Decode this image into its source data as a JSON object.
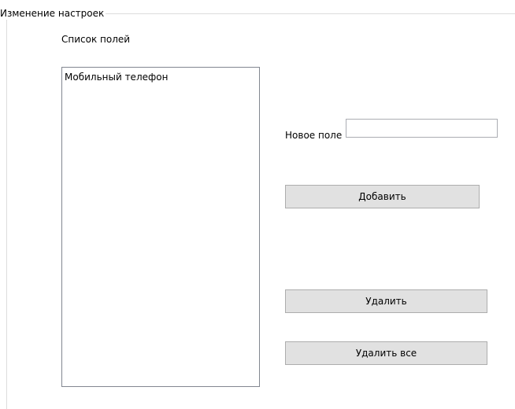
{
  "group": {
    "title": "Изменение настроек"
  },
  "fields_list": {
    "label": "Список полей",
    "items": [
      "Мобильный телефон"
    ]
  },
  "new_field": {
    "label": "Новое поле",
    "value": "",
    "placeholder": ""
  },
  "buttons": {
    "add_label": "Добавить",
    "delete_label": "Удалить",
    "delete_all_label": "Удалить все"
  }
}
